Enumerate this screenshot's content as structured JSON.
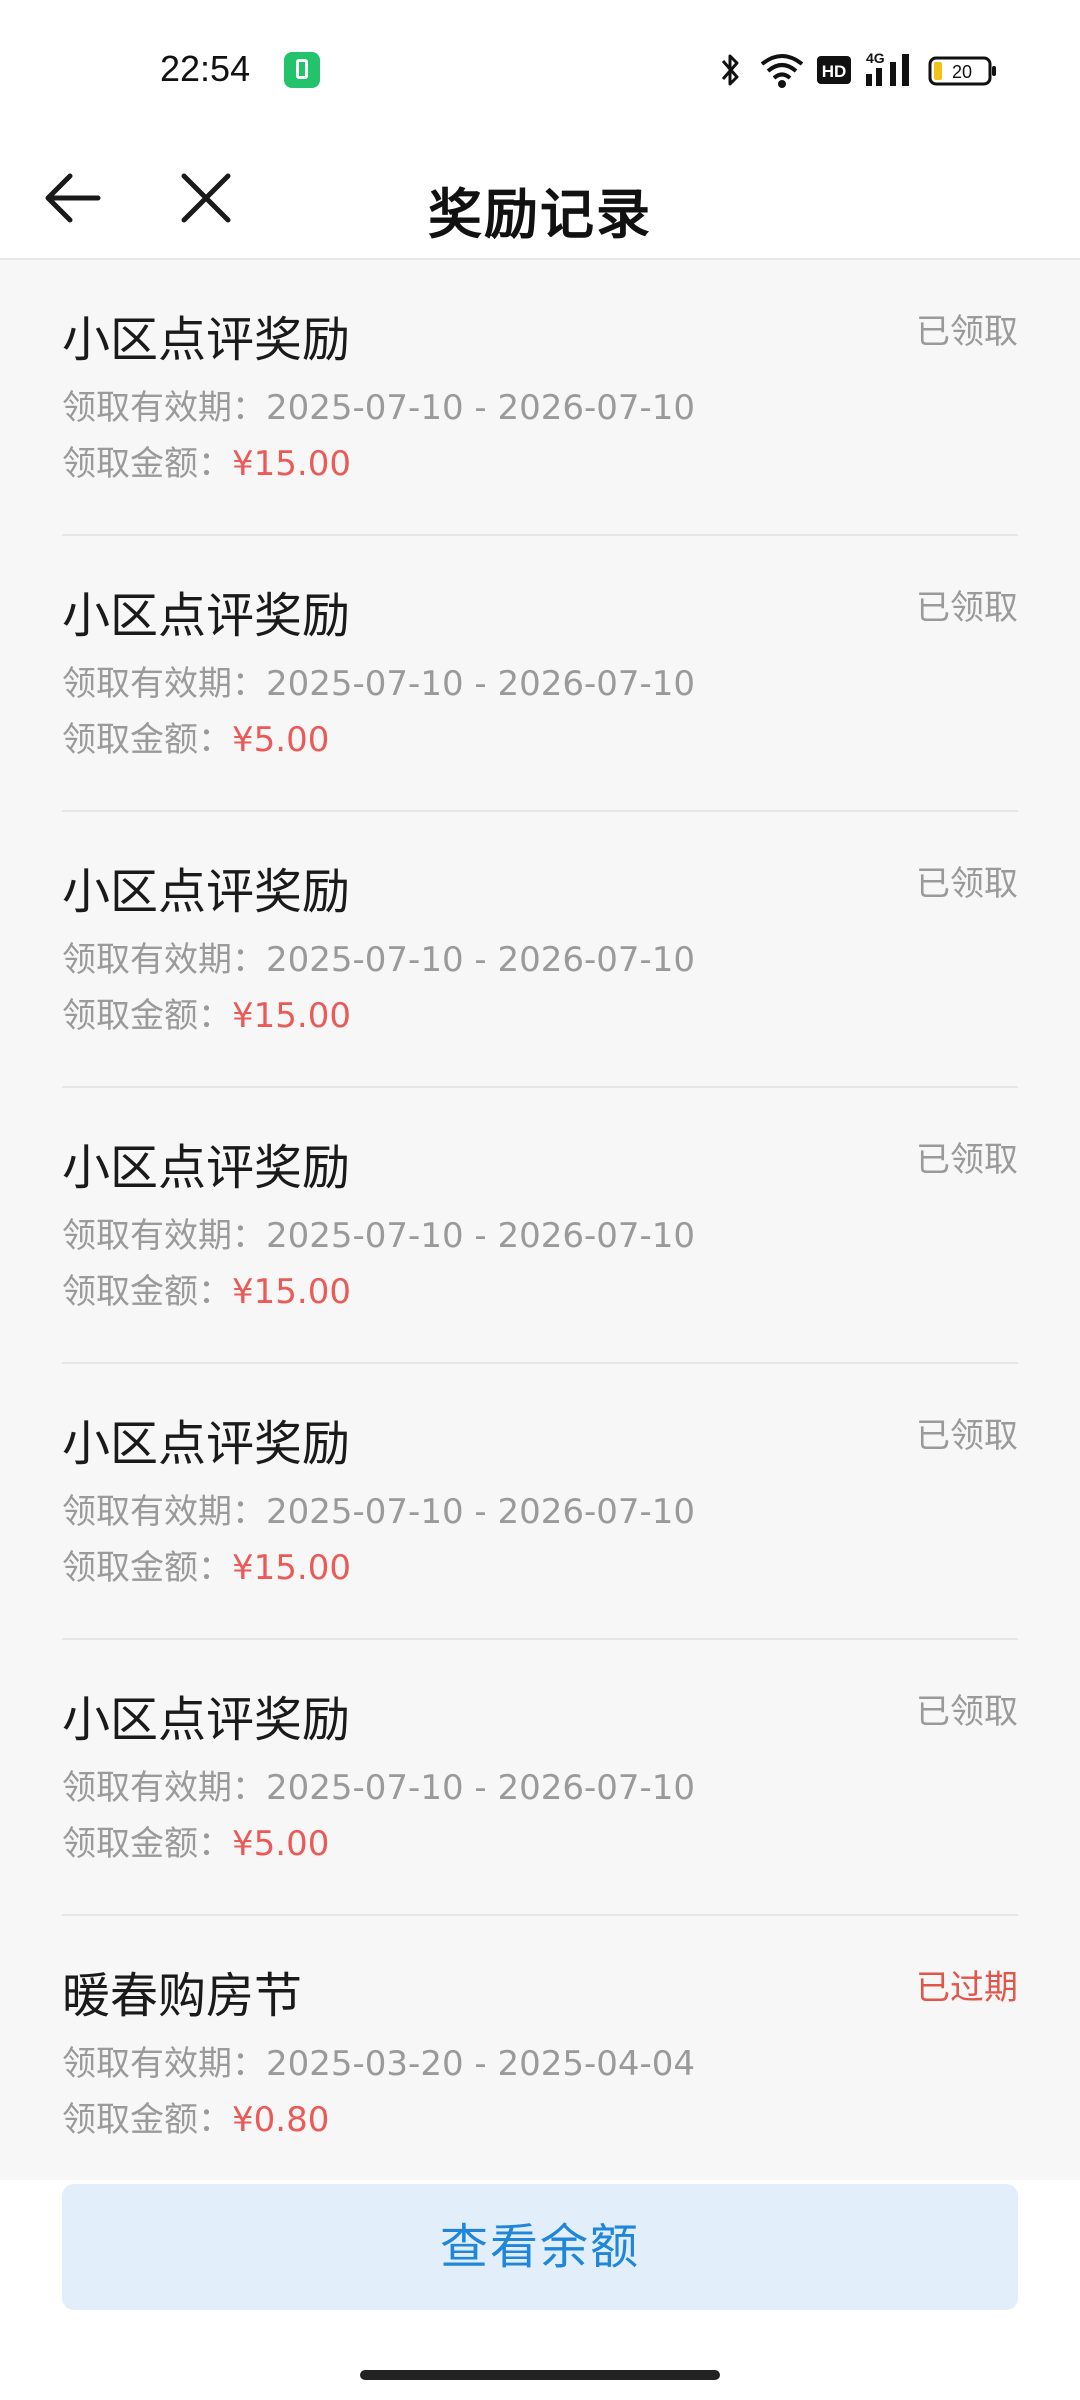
{
  "status_bar": {
    "time": "22:54",
    "battery": "20",
    "network": "4G",
    "hd": "HD"
  },
  "header": {
    "title": "奖励记录"
  },
  "records": [
    {
      "title": "小区点评奖励",
      "status": "已领取",
      "period_label": "领取有效期：",
      "period": "2025-07-10 - 2026-07-10",
      "amount_label": "领取金额：",
      "amount": "¥15.00"
    },
    {
      "title": "小区点评奖励",
      "status": "已领取",
      "period_label": "领取有效期：",
      "period": "2025-07-10 - 2026-07-10",
      "amount_label": "领取金额：",
      "amount": "¥5.00"
    },
    {
      "title": "小区点评奖励",
      "status": "已领取",
      "period_label": "领取有效期：",
      "period": "2025-07-10 - 2026-07-10",
      "amount_label": "领取金额：",
      "amount": "¥15.00"
    },
    {
      "title": "小区点评奖励",
      "status": "已领取",
      "period_label": "领取有效期：",
      "period": "2025-07-10 - 2026-07-10",
      "amount_label": "领取金额：",
      "amount": "¥15.00"
    },
    {
      "title": "小区点评奖励",
      "status": "已领取",
      "period_label": "领取有效期：",
      "period": "2025-07-10 - 2026-07-10",
      "amount_label": "领取金额：",
      "amount": "¥15.00"
    },
    {
      "title": "小区点评奖励",
      "status": "已领取",
      "period_label": "领取有效期：",
      "period": "2025-07-10 - 2026-07-10",
      "amount_label": "领取金额：",
      "amount": "¥5.00"
    },
    {
      "title": "暖春购房节",
      "status": "已过期",
      "period_label": "领取有效期：",
      "period": "2025-03-20 - 2025-04-04",
      "amount_label": "领取金额：",
      "amount": "¥0.80"
    }
  ],
  "bottom": {
    "balance_button": "查看余额"
  },
  "colors": {
    "accent": "#1f86d9",
    "amount": "#ea5a57",
    "expired": "#e0564a",
    "muted": "#9a9a9a"
  }
}
